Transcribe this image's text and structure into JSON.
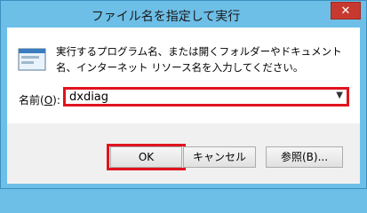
{
  "window": {
    "title": "ファイル名を指定して実行",
    "close_label": "✕"
  },
  "icon": "run-icon",
  "description": "実行するプログラム名、または開くフォルダーやドキュメント名、インターネット リソース名を入力してください。",
  "open_field": {
    "label_prefix": "名前(",
    "label_key": "O",
    "label_suffix": "):",
    "value": "dxdiag"
  },
  "buttons": {
    "ok": "OK",
    "cancel": "キャンセル",
    "browse": "参照(B)..."
  },
  "colors": {
    "accent": "#6dbfe7",
    "highlight": "#e0141e"
  }
}
